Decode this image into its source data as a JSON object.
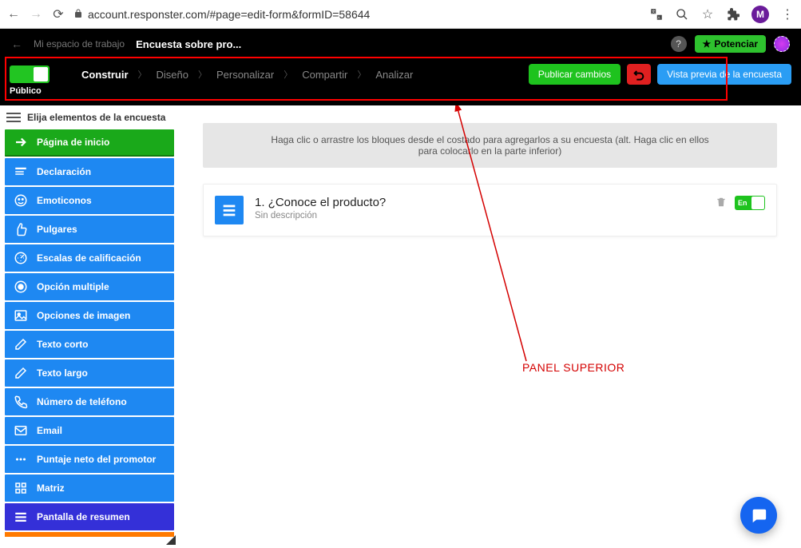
{
  "browser": {
    "url": "account.responster.com/#page=edit-form&formID=58644",
    "avatar_letter": "M"
  },
  "topbar": {
    "back_arrow": "←",
    "workspace": "Mi espacio de trabajo",
    "survey_title": "Encuesta sobre pro...",
    "potenciar": "Potenciar"
  },
  "navbar": {
    "toggle_label": "Público",
    "crumbs": {
      "construir": "Construir",
      "diseno": "Diseño",
      "personalizar": "Personalizar",
      "compartir": "Compartir",
      "analizar": "Analizar"
    },
    "publish": "Publicar cambios",
    "preview": "Vista previa de la encuesta"
  },
  "sidebar": {
    "header": "Elija elementos de la encuesta",
    "items": [
      {
        "label": "Página de inicio",
        "icon": "arrow-right",
        "variant": "green"
      },
      {
        "label": "Declaración",
        "icon": "declaration",
        "variant": "blue"
      },
      {
        "label": "Emoticonos",
        "icon": "smile",
        "variant": "blue"
      },
      {
        "label": "Pulgares",
        "icon": "thumb",
        "variant": "blue"
      },
      {
        "label": "Escalas de calificación",
        "icon": "scale",
        "variant": "blue"
      },
      {
        "label": "Opción multiple",
        "icon": "radio",
        "variant": "blue"
      },
      {
        "label": "Opciones de imagen",
        "icon": "image",
        "variant": "blue"
      },
      {
        "label": "Texto corto",
        "icon": "edit",
        "variant": "blue"
      },
      {
        "label": "Texto largo",
        "icon": "edit",
        "variant": "blue"
      },
      {
        "label": "Número de teléfono",
        "icon": "phone",
        "variant": "blue"
      },
      {
        "label": "Email",
        "icon": "mail",
        "variant": "blue"
      },
      {
        "label": "Puntaje neto del promotor",
        "icon": "dots",
        "variant": "blue"
      },
      {
        "label": "Matriz",
        "icon": "grid",
        "variant": "blue"
      },
      {
        "label": "Pantalla de resumen",
        "icon": "list",
        "variant": "indigo"
      }
    ]
  },
  "main": {
    "hint": "Haga clic o arrastre los bloques desde el costado para agregarlos a su encuesta (alt. Haga clic en ellos para colocarlo en la parte inferior)",
    "question": {
      "title": "1. ¿Conoce el producto?",
      "desc": "Sin descripción",
      "toggle_label": "En"
    }
  },
  "annotation": {
    "label": "PANEL SUPERIOR"
  },
  "colors": {
    "blue": "#1e88f2",
    "green": "#1ec31e",
    "indigo": "#3430d8",
    "red": "#e02020",
    "orange": "#ff7a00"
  }
}
